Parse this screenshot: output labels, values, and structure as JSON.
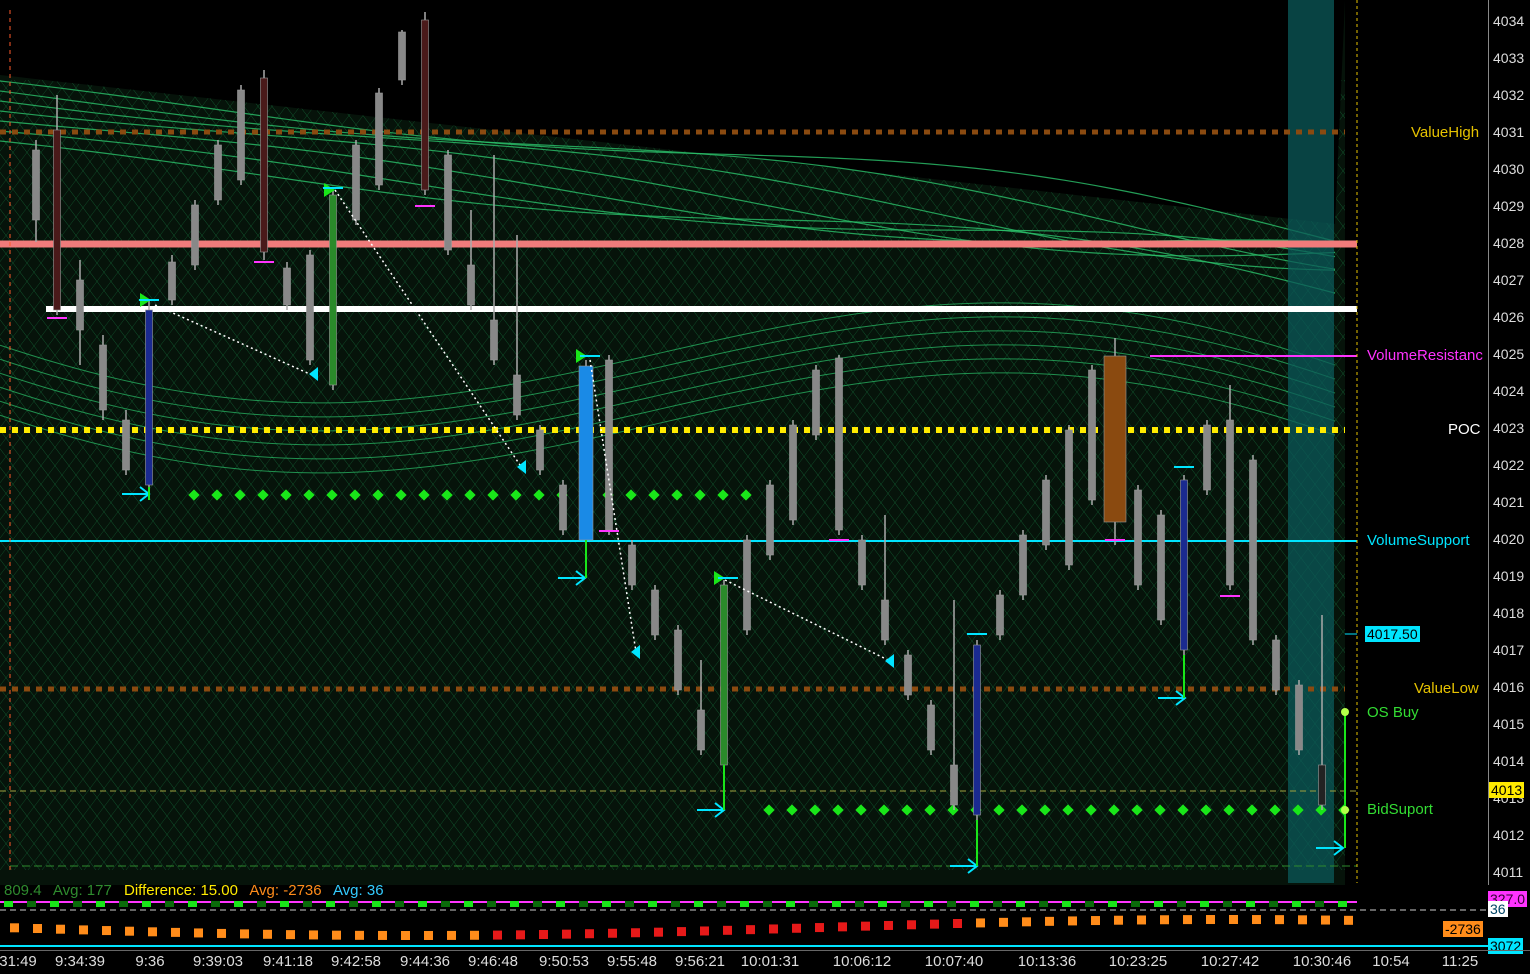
{
  "price_axis": {
    "ticks": [
      "4034",
      "4033",
      "4032",
      "4031",
      "4030",
      "4029",
      "4028",
      "4027",
      "4026",
      "4025",
      "4024",
      "4023",
      "4022",
      "4021",
      "4020",
      "4019",
      "4018",
      "4017",
      "4016",
      "4015",
      "4014",
      "4013",
      "4012",
      "4011"
    ],
    "current_price_box": "4013",
    "last_price_label": "4017.50"
  },
  "levels": {
    "value_high": "ValueHigh",
    "volume_resistance": "VolumeResistanc",
    "poc": "POC",
    "volume_support": "VolumeSupport",
    "value_low": "ValueLow",
    "os_buy": "OS Buy",
    "bid_support": "BidSuport"
  },
  "indicator_row": {
    "value_a": "809.4",
    "avg_a": "Avg: 177",
    "difference": "Difference: 15.00",
    "avg_b": "Avg: -2736",
    "avg_c": "Avg: 36"
  },
  "indicator_axis": {
    "top_box": "327.0",
    "mid_box": "36",
    "orange_box": "-2736",
    "bottom_box": "3072"
  },
  "time_axis": {
    "ticks": [
      "31:49",
      "9:34:39",
      "9:36",
      "9:39:03",
      "9:41:18",
      "9:42:58",
      "9:44:36",
      "9:46:48",
      "9:50:53",
      "9:55:48",
      "9:56:21",
      "10:01:31",
      "10:06:12",
      "10:07:40",
      "10:13:36",
      "10:23:25",
      "10:27:42",
      "10:30:46",
      "10:54",
      "11:25"
    ]
  },
  "colors": {
    "background": "#000000",
    "mesh": "#1f9e55",
    "value_high": "#e6c200",
    "volume_resistance": "#ff33ff",
    "poc": "#ffffff",
    "volume_support": "#00e5ff",
    "value_low": "#e6c200",
    "os_buy": "#33dd33",
    "bid_support": "#33dd33"
  }
}
